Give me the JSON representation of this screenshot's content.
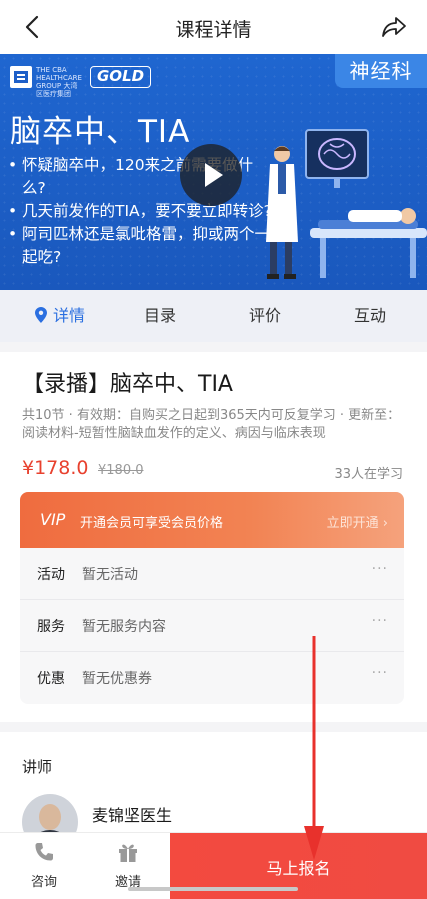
{
  "header": {
    "title": "课程详情",
    "back_icon": "chevron-left-icon",
    "share_icon": "share-icon"
  },
  "banner": {
    "org": "THE CBA HEALTHCARE GROUP 大湾区医疗集团",
    "gold": "GOLD",
    "tag": "神经科",
    "title": "脑卒中、TIA",
    "bullets": [
      "怀疑脑卒中，120来之前需要做什么?",
      "几天前发作的TIA，要不要立即转诊?",
      "阿司匹林还是氯吡格雷，抑或两个一起吃?"
    ],
    "bg_color": "#1d5fc8"
  },
  "tabs": [
    {
      "label": "详情",
      "active": true
    },
    {
      "label": "目录"
    },
    {
      "label": "评价"
    },
    {
      "label": "互动"
    }
  ],
  "course": {
    "title": "【录播】脑卒中、TIA",
    "meta": "共10节 · 有效期：自购买之日起到365天内可反复学习 · 更新至：阅读材料-短暂性脑缺血发作的定义、病因与临床表现",
    "price": "¥178.0",
    "price_old": "¥180.0",
    "learners": "33人在学习"
  },
  "vip": {
    "tag": "VIP",
    "text": "开通会员可享受会员价格",
    "cta": "立即开通 ›"
  },
  "rows": [
    {
      "label": "活动",
      "value": "暂无活动",
      "more": "···"
    },
    {
      "label": "服务",
      "value": "暂无服务内容",
      "more": "···"
    },
    {
      "label": "优惠",
      "value": "暂无优惠券",
      "more": "···"
    }
  ],
  "teacher": {
    "heading": "讲师",
    "name": "麦锦坚医生"
  },
  "bottom": {
    "consult": "咨询",
    "invite": "邀请",
    "enroll": "马上报名"
  },
  "colors": {
    "accent": "#2b6fe0",
    "price": "#e8412e",
    "enroll": "#f34a3f",
    "annotation_arrow": "#e8312c"
  }
}
